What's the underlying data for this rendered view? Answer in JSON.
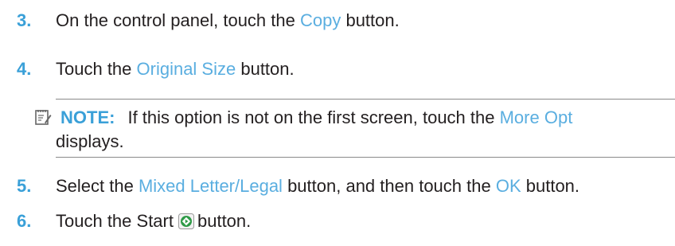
{
  "steps": [
    {
      "number": "3.",
      "text_before": "On the control panel, touch the ",
      "ui": "Copy",
      "text_after": " button."
    },
    {
      "number": "4.",
      "text_before": "Touch the ",
      "ui": "Original Size",
      "text_after": " button."
    },
    {
      "number": "5.",
      "text_before": "Select the ",
      "ui": "Mixed Letter/Legal",
      "text_middle": " button, and then touch the ",
      "ui2": "OK",
      "text_after": " button."
    },
    {
      "number": "6.",
      "text_before": "Touch the Start",
      "text_after": "button."
    }
  ],
  "note": {
    "label": "NOTE:",
    "text": "If this option is not on the first screen, touch the ",
    "ui": "More Opt",
    "line2": "displays."
  },
  "icons": {
    "note": "note-pad-icon",
    "start": "start-button-icon"
  },
  "colors": {
    "accent": "#3aa0d8",
    "ui_text": "#5aaee0",
    "body_text": "#231f20",
    "start_icon": "#2e9a47"
  }
}
